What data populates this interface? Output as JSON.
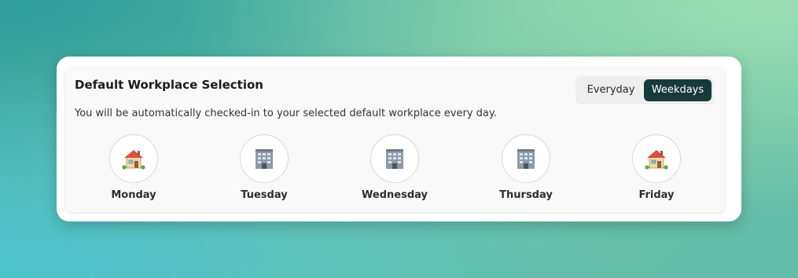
{
  "panel": {
    "title": "Default Workplace Selection",
    "description": "You will be automatically checked-in to your selected default workplace every day."
  },
  "toggle": {
    "options": [
      "Everyday",
      "Weekdays"
    ],
    "selected": "Weekdays",
    "selected_color": "#163a3a"
  },
  "days": [
    {
      "label": "Monday",
      "workplace_icon": "house-icon"
    },
    {
      "label": "Tuesday",
      "workplace_icon": "office-building-icon"
    },
    {
      "label": "Wednesday",
      "workplace_icon": "office-building-icon"
    },
    {
      "label": "Thursday",
      "workplace_icon": "office-building-icon"
    },
    {
      "label": "Friday",
      "workplace_icon": "house-icon"
    }
  ]
}
